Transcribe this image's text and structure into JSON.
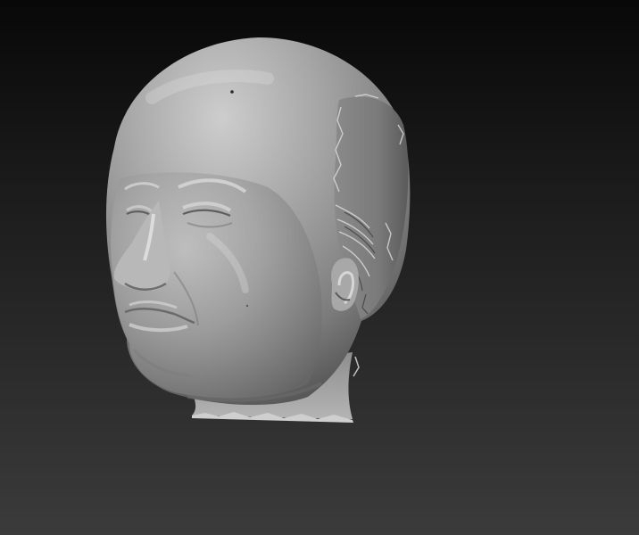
{
  "scene": {
    "subject": "sculpted-head-mesh",
    "background_top_color": "#080808",
    "background_bottom_color": "#3b3b3b",
    "material_color": "#9a9a9a"
  }
}
